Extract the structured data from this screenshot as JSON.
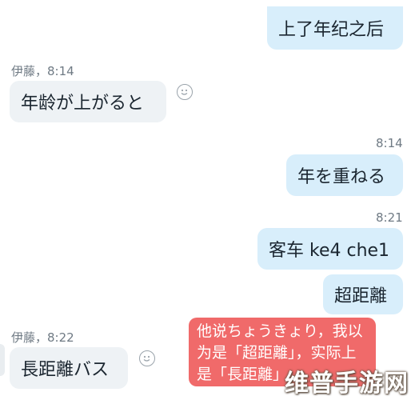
{
  "messages": [
    {
      "id": "m1",
      "text": "上了年纪之后"
    },
    {
      "id": "m2",
      "sender": "伊藤，8:14",
      "text": "年龄が上がると"
    },
    {
      "id": "m3",
      "time": "8:14",
      "text": "年を重ねる"
    },
    {
      "id": "m4",
      "time": "8:21",
      "text": "客车 ke4 che1"
    },
    {
      "id": "m5",
      "text": "超距離"
    },
    {
      "id": "m6",
      "sender": "伊藤，8:22",
      "text": "長距離バス"
    }
  ],
  "annotation": {
    "text": "他说ちょうきょり，我以\n为是「超距離」，实际上\n是「長距離」"
  },
  "watermark": "维普手游网",
  "colors": {
    "outgoing_bubble": "#d8eefb",
    "incoming_bubble": "#eef2f5",
    "annotation": "#f06a6a"
  },
  "icons": {
    "reaction": "smiley-icon"
  }
}
